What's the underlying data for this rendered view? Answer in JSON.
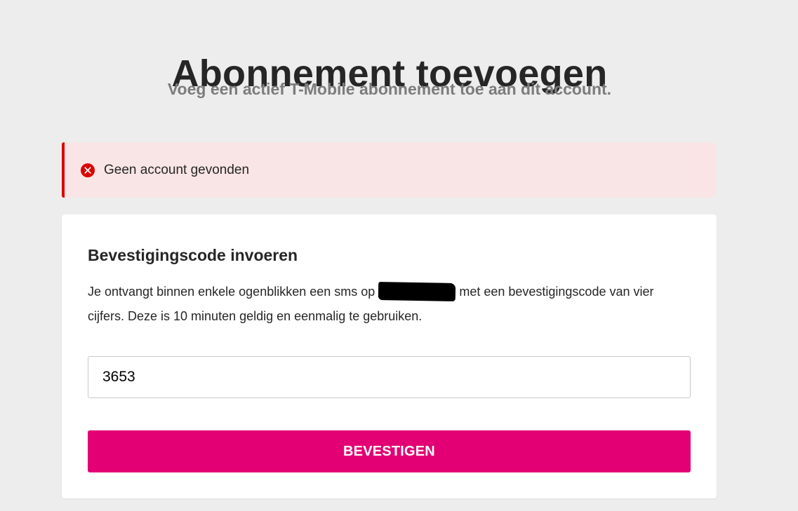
{
  "header": {
    "title": "Abonnement toevoegen",
    "subtitle": "Voeg een actief T-Mobile abonnement toe aan dit account."
  },
  "alert": {
    "type": "error",
    "icon": "error-circle-x-icon",
    "message": "Geen account gevonden",
    "color": "#d90000"
  },
  "form": {
    "title": "Bevestigingscode invoeren",
    "description_before": "Je ontvangt binnen enkele ogenblikken een sms op",
    "description_after": "met een bevestigingscode van vier cijfers. Deze is 10 minuten geldig en eenmalig te gebruiken.",
    "code_value": "3653",
    "button_label": "BEVESTIGEN",
    "button_color": "#e20074"
  }
}
